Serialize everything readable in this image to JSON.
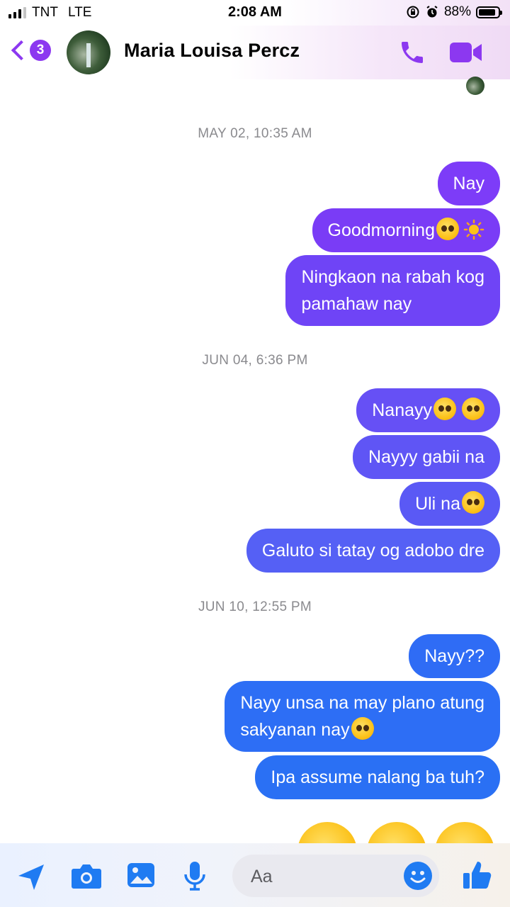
{
  "status_bar": {
    "carrier": "TNT",
    "network": "LTE",
    "time": "2:08 AM",
    "battery_percent": "88%",
    "battery_level": 0.88
  },
  "header": {
    "back_badge": "3",
    "contact_name": "Maria Louisa Percz",
    "accent_color": "#8c38f0"
  },
  "conversation": [
    {
      "timestamp": "MAY 02, 10:35 AM",
      "messages": [
        {
          "text": "Nay",
          "color": "#7d3cf8"
        },
        {
          "text": "Goodmorning",
          "emoji": [
            "pleading-face",
            "sun"
          ],
          "color": "#7a3cf6"
        },
        {
          "line1": "Ningkaon na rabah kog",
          "line2": "pamahaw nay",
          "color": "#6f44f6"
        }
      ]
    },
    {
      "timestamp": "JUN 04, 6:36 PM",
      "messages": [
        {
          "text": "Nanayy",
          "emoji": [
            "pleading-face",
            "disappointed-face"
          ],
          "color": "#6650f5"
        },
        {
          "text": "Nayyy gabii na",
          "color": "#5f55f5"
        },
        {
          "text": "Uli na",
          "emoji": [
            "confounded-face"
          ],
          "color": "#5a59f5"
        },
        {
          "text": "Galuto si tatay og adobo dre",
          "color": "#5560f5"
        }
      ]
    },
    {
      "timestamp": "JUN 10, 12:55 PM",
      "messages": [
        {
          "text": "Nayy??",
          "color": "#2f6cf5"
        },
        {
          "line1": "Nayy unsa na may plano atung",
          "line2": "sakyanan nay",
          "emoji": [
            "pleading-face"
          ],
          "color": "#2d6ef5"
        },
        {
          "text": "Ipa assume nalang ba tuh?",
          "color": "#2a70f4"
        }
      ]
    }
  ],
  "composer": {
    "placeholder": "Aa",
    "icon_color": "#1f7bf2"
  }
}
